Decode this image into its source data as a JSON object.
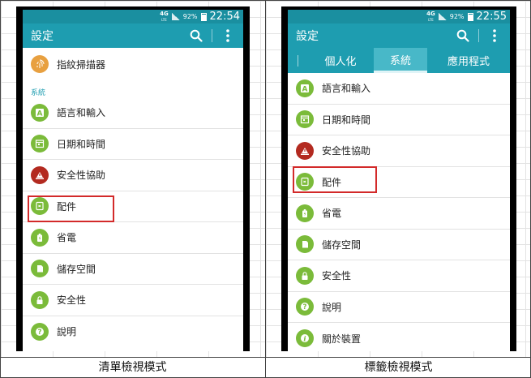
{
  "left": {
    "statusbar": {
      "network": "4G",
      "network_sub": "LTE",
      "battery": "92%",
      "time": "22:54"
    },
    "appbar": {
      "title": "設定"
    },
    "top_item": {
      "label": "指紋掃描器"
    },
    "section": "系統",
    "items": [
      {
        "label": "語言和輸入"
      },
      {
        "label": "日期和時間"
      },
      {
        "label": "安全性協助"
      },
      {
        "label": "配件"
      },
      {
        "label": "省電"
      },
      {
        "label": "儲存空間"
      },
      {
        "label": "安全性"
      },
      {
        "label": "說明"
      }
    ],
    "caption": "清單檢視模式"
  },
  "right": {
    "statusbar": {
      "network": "4G",
      "network_sub": "LTE",
      "battery": "92%",
      "time": "22:55"
    },
    "appbar": {
      "title": "設定"
    },
    "tabs": [
      "個人化",
      "系統",
      "應用程式"
    ],
    "items": [
      {
        "label": "語言和輸入"
      },
      {
        "label": "日期和時間"
      },
      {
        "label": "安全性協助"
      },
      {
        "label": "配件"
      },
      {
        "label": "省電"
      },
      {
        "label": "儲存空間"
      },
      {
        "label": "安全性"
      },
      {
        "label": "說明"
      },
      {
        "label": "關於裝置"
      }
    ],
    "caption": "標籤檢視模式"
  },
  "colors": {
    "appbar": "#1e9db0",
    "statusbar": "#1a8fa0",
    "icon_green": "#7bbb3a",
    "icon_red": "#b32a20",
    "icon_orange": "#e8a040",
    "highlight": "#d32a2a"
  }
}
